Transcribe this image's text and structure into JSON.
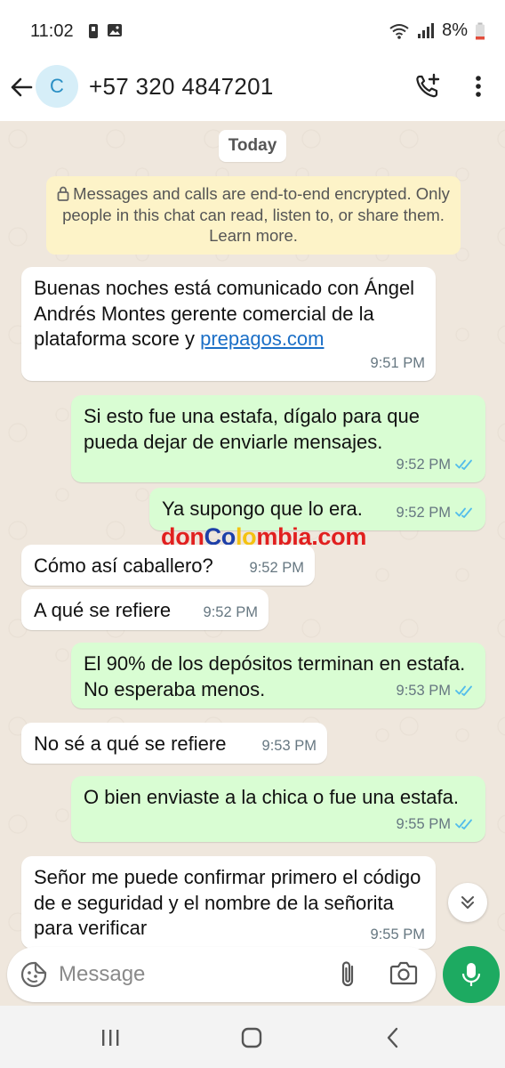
{
  "status_bar": {
    "time": "11:02",
    "battery": "8%"
  },
  "header": {
    "avatar_letter": "C",
    "contact": "+57 320 4847201"
  },
  "chat": {
    "date_chip": "Today",
    "encryption_notice": "Messages and calls are end-to-end encrypted. Only people in this chat can read, listen to, or share them. Learn more.",
    "messages": [
      {
        "dir": "in",
        "text": "Buenas noches está comunicado con Ángel Andrés Montes gerente comercial de la plataforma score y ",
        "link": "prepagos.com",
        "time": "9:51 PM"
      },
      {
        "dir": "out",
        "text": "Si esto fue una estafa, dígalo para que pueda dejar de enviarle mensajes.",
        "time": "9:52 PM",
        "status": "read"
      },
      {
        "dir": "out",
        "text": "Ya supongo que lo era.",
        "time": "9:52 PM",
        "status": "read"
      },
      {
        "dir": "in",
        "text": "Cómo así caballero?",
        "time": "9:52 PM"
      },
      {
        "dir": "in",
        "text": "A qué se refiere",
        "time": "9:52 PM"
      },
      {
        "dir": "out",
        "text": "El 90% de los depósitos terminan en estafa. No esperaba menos.",
        "time": "9:53 PM",
        "status": "read"
      },
      {
        "dir": "in",
        "text": "No sé a qué se refiere",
        "time": "9:53 PM"
      },
      {
        "dir": "out",
        "text": "O bien enviaste a la chica o fue una estafa.",
        "time": "9:55 PM",
        "status": "read"
      },
      {
        "dir": "in",
        "text": "Señor me puede confirmar primero el código de e seguridad y el nombre de la señorita para verificar",
        "time": "9:55 PM"
      }
    ],
    "watermark": {
      "part1": "don",
      "part2": "Co",
      "part3": "lo",
      "part4": "mbia.com"
    }
  },
  "composer": {
    "placeholder": "Message"
  },
  "colors": {
    "outgoing_bubble": "#d9fdd3",
    "incoming_bubble": "#ffffff",
    "chat_bg": "#efe7dd",
    "accent": "#1daa61",
    "read_ticks": "#53bdeb"
  },
  "icons": [
    "back-arrow-icon",
    "add-call-icon",
    "more-vertical-icon",
    "lock-icon",
    "double-check-icon",
    "chevrons-down-icon",
    "emoji-icon",
    "attach-icon",
    "camera-icon",
    "mic-icon",
    "recents-icon",
    "home-icon",
    "back-icon"
  ]
}
